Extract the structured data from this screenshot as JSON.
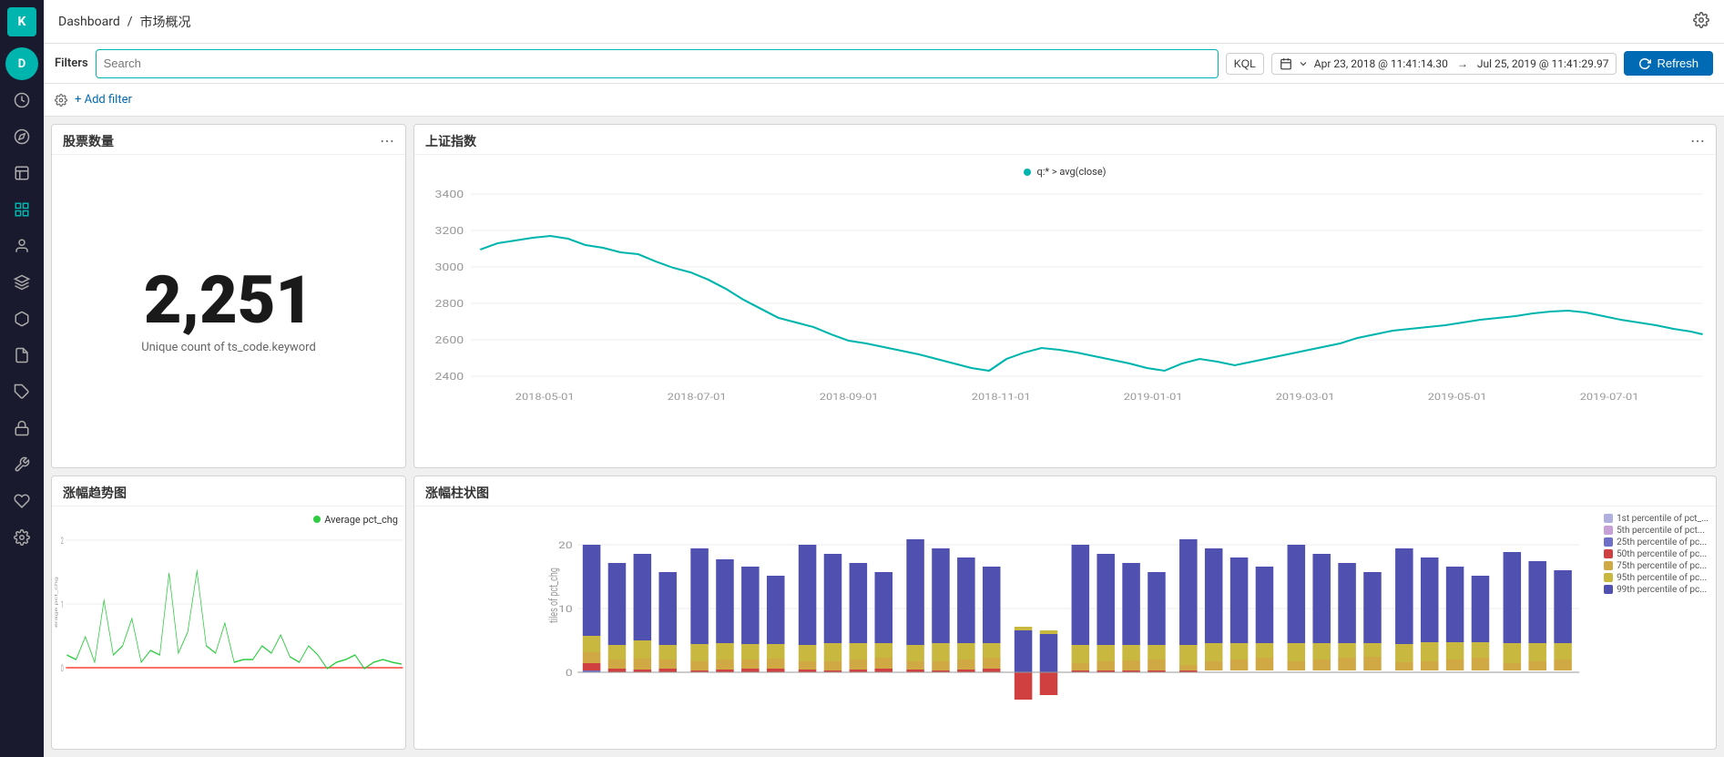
{
  "app": {
    "logo_text": "K",
    "breadcrumb_parent": "Dashboard",
    "breadcrumb_sep": "/",
    "breadcrumb_current": "市场概况",
    "settings_icon": "⚙"
  },
  "filterbar": {
    "filters_label": "Filters",
    "search_placeholder": "Search",
    "kql_label": "KQL",
    "date_icon": "📅",
    "date_start": "Apr 23, 2018 @ 11:41:14.30",
    "date_arrow": "→",
    "date_end": "Jul 25, 2019 @ 11:41:29.97",
    "refresh_label": "Refresh"
  },
  "addfilter": {
    "gear_icon": "⚙",
    "add_filter_label": "+ Add filter"
  },
  "panels": {
    "stock_count": {
      "title": "股票数量",
      "value": "2,251",
      "label": "Unique count of ts_code.keyword"
    },
    "index_chart": {
      "title": "上证指数",
      "legend_label": "q:* > avg(close)",
      "y_labels": [
        "3400",
        "3200",
        "3000",
        "2800",
        "2600",
        "2400"
      ],
      "x_labels": [
        "2018-05-01",
        "2018-07-01",
        "2018-09-01",
        "2018-11-01",
        "2019-01-01",
        "2019-03-01",
        "2019-05-01",
        "2019-07-01"
      ]
    },
    "trend_chart": {
      "title": "涨幅趋势图",
      "legend_label": "Average pct_chg",
      "y_labels": [
        "2",
        "1",
        "0"
      ],
      "y_axis_label": "erage pct_chg"
    },
    "bar_chart": {
      "title": "涨幅柱状图",
      "y_labels": [
        "20",
        "10",
        "0"
      ],
      "y_axis_label": "tiles of pct_chg",
      "legend": [
        {
          "label": "1st percentile of pct_...",
          "color": "#b0b0e0"
        },
        {
          "label": "5th percentile of pct...",
          "color": "#c0a0d0"
        },
        {
          "label": "25th percentile of pc...",
          "color": "#7070c0"
        },
        {
          "label": "50th percentile of pc...",
          "color": "#e07070"
        },
        {
          "label": "75th percentile of pc...",
          "color": "#d0a040"
        },
        {
          "label": "95th percentile of pc...",
          "color": "#c8b840"
        },
        {
          "label": "99th percentile of pc...",
          "color": "#5050b0"
        }
      ]
    }
  },
  "sidebar": {
    "items": [
      {
        "icon": "clock",
        "label": "Recent"
      },
      {
        "icon": "compass",
        "label": "Discover"
      },
      {
        "icon": "chart-bar",
        "label": "Visualize"
      },
      {
        "icon": "dashboard",
        "label": "Dashboard"
      },
      {
        "icon": "user",
        "label": "User"
      },
      {
        "icon": "layers",
        "label": "Layers"
      },
      {
        "icon": "cog",
        "label": "Settings"
      },
      {
        "icon": "box",
        "label": "Box"
      },
      {
        "icon": "file",
        "label": "Reports"
      },
      {
        "icon": "tag",
        "label": "Tags"
      },
      {
        "icon": "lock",
        "label": "Security"
      },
      {
        "icon": "tools",
        "label": "Tools"
      },
      {
        "icon": "heart",
        "label": "Favorites"
      },
      {
        "icon": "gear",
        "label": "Gear"
      }
    ]
  }
}
